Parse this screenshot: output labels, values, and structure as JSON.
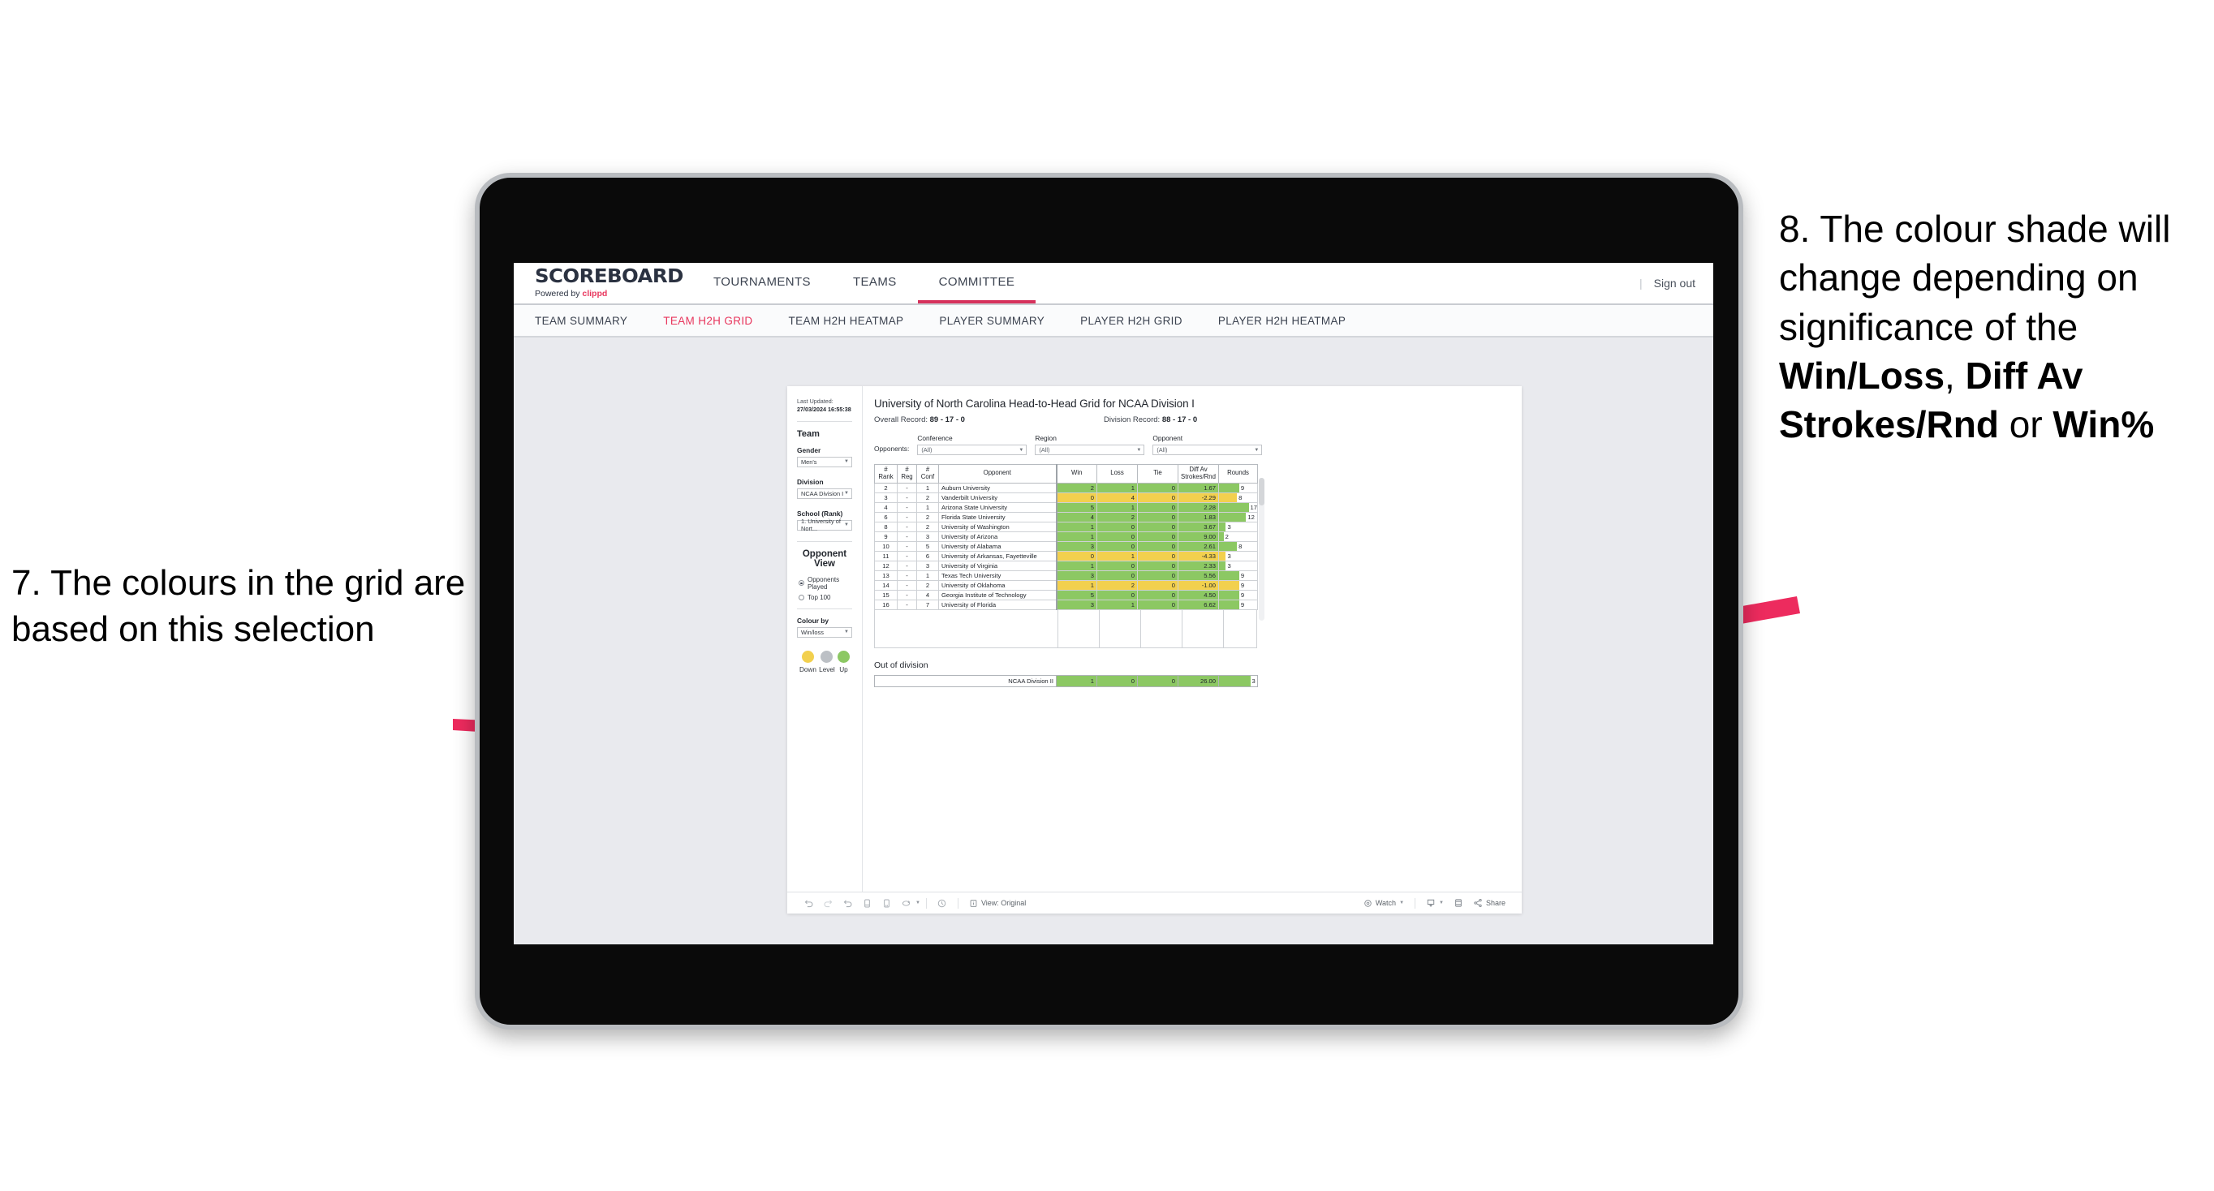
{
  "annotations": {
    "left": {
      "id": "annotation-7",
      "text": "7. The colours in the grid are based on this selection"
    },
    "right": {
      "id": "annotation-8",
      "line1": "8. The colour shade will change depending on significance of the ",
      "bold1": "Win/Loss",
      "mid1": ", ",
      "bold2": "Diff Av Strokes/Rnd",
      "mid2": " or ",
      "bold3": "Win%"
    },
    "arrow_color": "#ED २B5E"
  },
  "app": {
    "logo": {
      "wordmark": "SCOREBOARD",
      "powered_prefix": "Powered by ",
      "brand": "clippd"
    },
    "topnav": [
      {
        "label": "TOURNAMENTS",
        "active": false
      },
      {
        "label": "TEAMS",
        "active": false
      },
      {
        "label": "COMMITTEE",
        "active": true
      }
    ],
    "header_right": {
      "divider": "|",
      "signout": "Sign out"
    },
    "subnav": [
      {
        "label": "TEAM SUMMARY",
        "active": false
      },
      {
        "label": "TEAM H2H GRID",
        "active": true
      },
      {
        "label": "TEAM H2H HEATMAP",
        "active": false
      },
      {
        "label": "PLAYER SUMMARY",
        "active": false
      },
      {
        "label": "PLAYER H2H GRID",
        "active": false
      },
      {
        "label": "PLAYER H2H HEATMAP",
        "active": false
      }
    ],
    "accent": "#e8365d"
  },
  "panel": {
    "last_updated_label": "Last Updated: ",
    "last_updated_value": "27/03/2024 16:55:38",
    "team_title": "Team",
    "fields": [
      {
        "label": "Gender",
        "value": "Men's"
      },
      {
        "label": "Division",
        "value": "NCAA Division I"
      },
      {
        "label": "School (Rank)",
        "value": "1. University of Nort..."
      }
    ],
    "opponent_view_title": "Opponent View",
    "opponent_view_options": [
      {
        "label": "Opponents Played",
        "selected": true
      },
      {
        "label": "Top 100",
        "selected": false
      }
    ],
    "colour_by_label": "Colour by",
    "colour_by_value": "Win/loss",
    "legend": [
      {
        "label": "Down",
        "color": "#f2d04e"
      },
      {
        "label": "Level",
        "color": "#bcc0c5"
      },
      {
        "label": "Up",
        "color": "#8cc863"
      }
    ]
  },
  "sheet": {
    "title": "University of North Carolina Head-to-Head Grid for NCAA Division I",
    "overall_record_label": "Overall Record: ",
    "overall_record_value": "89 - 17 - 0",
    "division_record_label": "Division Record: ",
    "division_record_value": "88 - 17 - 0",
    "opponents_label": "Opponents:",
    "filters": [
      {
        "label": "Conference",
        "value": "(All)"
      },
      {
        "label": "Region",
        "value": "(All)"
      },
      {
        "label": "Opponent",
        "value": "(All)"
      }
    ],
    "out_of_division_title": "Out of division",
    "out_of_division_row": {
      "name": "NCAA Division II",
      "win": "1",
      "loss": "0",
      "tie": "0",
      "diff": "26.00",
      "rounds": "3",
      "color": "#8cc863",
      "bar_pct": 82
    }
  },
  "chart_data": {
    "type": "table",
    "title": "University of North Carolina Head-to-Head Grid for NCAA Division I",
    "columns": [
      "# Rank",
      "# Reg",
      "# Conf",
      "Opponent",
      "Win",
      "Loss",
      "Tie",
      "Diff Av Strokes/Rnd",
      "Rounds"
    ],
    "header_lines": {
      "rank": [
        "#",
        "Rank"
      ],
      "reg": [
        "#",
        "Reg"
      ],
      "conf": [
        "#",
        "Conf"
      ],
      "opponent": [
        "Opponent"
      ],
      "win": [
        "Win"
      ],
      "loss": [
        "Loss"
      ],
      "tie": [
        "Tie"
      ],
      "diff": [
        "Diff Av",
        "Strokes/Rnd"
      ],
      "rounds": [
        "Rounds"
      ]
    },
    "colour_by": "Win/loss",
    "colors": {
      "up": "#8cc863",
      "down": "#f2d04e",
      "level": "#bcc0c5"
    },
    "rounds_max": 17,
    "rows": [
      {
        "rank": "2",
        "reg": "-",
        "conf": "1",
        "opponent": "Auburn University",
        "win": "2",
        "loss": "1",
        "tie": "0",
        "diff": "1.67",
        "rounds": 9,
        "color": "#8cc863"
      },
      {
        "rank": "3",
        "reg": "-",
        "conf": "2",
        "opponent": "Vanderbilt University",
        "win": "0",
        "loss": "4",
        "tie": "0",
        "diff": "-2.29",
        "rounds": 8,
        "color": "#f2d04e"
      },
      {
        "rank": "4",
        "reg": "-",
        "conf": "1",
        "opponent": "Arizona State University",
        "win": "5",
        "loss": "1",
        "tie": "0",
        "diff": "2.28",
        "rounds": 17,
        "color": "#8cc863"
      },
      {
        "rank": "6",
        "reg": "-",
        "conf": "2",
        "opponent": "Florida State University",
        "win": "4",
        "loss": "2",
        "tie": "0",
        "diff": "1.83",
        "rounds": 12,
        "color": "#8cc863"
      },
      {
        "rank": "8",
        "reg": "-",
        "conf": "2",
        "opponent": "University of Washington",
        "win": "1",
        "loss": "0",
        "tie": "0",
        "diff": "3.67",
        "rounds": 3,
        "color": "#8cc863"
      },
      {
        "rank": "9",
        "reg": "-",
        "conf": "3",
        "opponent": "University of Arizona",
        "win": "1",
        "loss": "0",
        "tie": "0",
        "diff": "9.00",
        "rounds": 2,
        "color": "#8cc863"
      },
      {
        "rank": "10",
        "reg": "-",
        "conf": "5",
        "opponent": "University of Alabama",
        "win": "3",
        "loss": "0",
        "tie": "0",
        "diff": "2.61",
        "rounds": 8,
        "color": "#8cc863"
      },
      {
        "rank": "11",
        "reg": "-",
        "conf": "6",
        "opponent": "University of Arkansas, Fayetteville",
        "win": "0",
        "loss": "1",
        "tie": "0",
        "diff": "-4.33",
        "rounds": 3,
        "color": "#f2d04e"
      },
      {
        "rank": "12",
        "reg": "-",
        "conf": "3",
        "opponent": "University of Virginia",
        "win": "1",
        "loss": "0",
        "tie": "0",
        "diff": "2.33",
        "rounds": 3,
        "color": "#8cc863"
      },
      {
        "rank": "13",
        "reg": "-",
        "conf": "1",
        "opponent": "Texas Tech University",
        "win": "3",
        "loss": "0",
        "tie": "0",
        "diff": "5.56",
        "rounds": 9,
        "color": "#8cc863"
      },
      {
        "rank": "14",
        "reg": "-",
        "conf": "2",
        "opponent": "University of Oklahoma",
        "win": "1",
        "loss": "2",
        "tie": "0",
        "diff": "-1.00",
        "rounds": 9,
        "color": "#f2d04e"
      },
      {
        "rank": "15",
        "reg": "-",
        "conf": "4",
        "opponent": "Georgia Institute of Technology",
        "win": "5",
        "loss": "0",
        "tie": "0",
        "diff": "4.50",
        "rounds": 9,
        "color": "#8cc863"
      },
      {
        "rank": "16",
        "reg": "-",
        "conf": "7",
        "opponent": "University of Florida",
        "win": "3",
        "loss": "1",
        "tie": "0",
        "diff": "6.62",
        "rounds": 9,
        "color": "#8cc863"
      }
    ]
  },
  "toolbar": {
    "view_label": "View: Original",
    "watch_label": "Watch",
    "share_label": "Share"
  }
}
